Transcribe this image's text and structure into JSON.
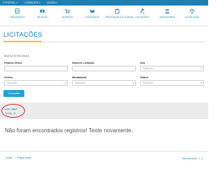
{
  "topbar": {
    "menus": [
      {
        "label": "O PORTAL"
      },
      {
        "label": "CONSULTE"
      },
      {
        "label": "AJUDA"
      }
    ]
  },
  "nav": {
    "items": [
      {
        "label": "ORÇAMENTO",
        "icon": "document-icon"
      },
      {
        "label": "RECEITA",
        "icon": "money-icon"
      },
      {
        "label": "DESPESA",
        "icon": "cart-icon"
      },
      {
        "label": "CONVÊNIOS",
        "icon": "handshake-icon"
      },
      {
        "label": "PRESTAÇÃO DE CONTAS",
        "icon": "clipboard-icon"
      },
      {
        "label": "LICITAÇÕES",
        "icon": "gavel-icon"
      },
      {
        "label": "SERVIDORES",
        "icon": "people-icon"
      },
      {
        "label": "LEGISLAÇÃO",
        "icon": "scale-icon"
      }
    ]
  },
  "page": {
    "title": "LICITAÇÕES",
    "busca_label": "BUSCA DETALHADA"
  },
  "form": {
    "palavra_label": "Palavra Chave",
    "numero_label": "Número Licitação",
    "ano_label": "Ano",
    "ano_value": "Selecione",
    "gestor_label": "Gestor",
    "gestor_value": "Selecione",
    "modalidade_label": "Modalidade",
    "modalidade_value": "Selecione",
    "status_label": "Status",
    "status_value": "Selecione",
    "submit_label": "Consultar"
  },
  "results": {
    "ano_prefix": "ANO:",
    "ano_value": "2017",
    "total_prefix": "TOTAL:",
    "total_value": "0",
    "message": "Não foram encontrados registros! Tente novamente."
  },
  "footer": {
    "voltar": "Voltar",
    "pagina_inicial": "Página Inicial",
    "acessivel": "Site Acessível",
    "social": [
      "f",
      "t"
    ]
  },
  "colors": {
    "brand_blue": "#1e7fb3",
    "button_blue": "#22a3d4",
    "highlight_yellow": "#f5c518",
    "annotation_red": "#d0202a"
  }
}
